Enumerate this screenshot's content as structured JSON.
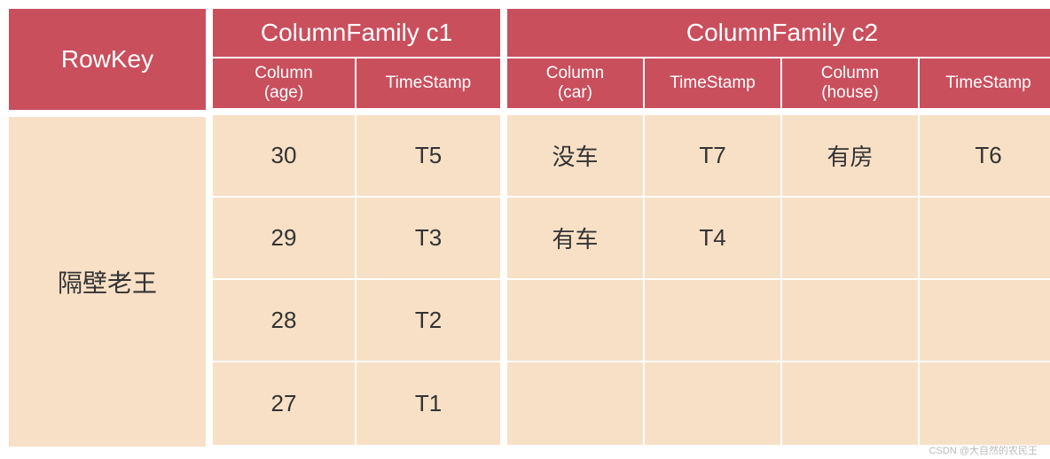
{
  "rowkey": {
    "header": "RowKey",
    "value": "隔壁老王"
  },
  "cf1": {
    "title": "ColumnFamily c1",
    "columns": [
      "Column\n(age)",
      "TimeStamp"
    ],
    "rows": [
      [
        "30",
        "T5"
      ],
      [
        "29",
        "T3"
      ],
      [
        "28",
        "T2"
      ],
      [
        "27",
        "T1"
      ]
    ]
  },
  "cf2": {
    "title": "ColumnFamily c2",
    "columns": [
      "Column\n(car)",
      "TimeStamp",
      "Column\n(house)",
      "TimeStamp"
    ],
    "rows": [
      [
        "没车",
        "T7",
        "有房",
        "T6"
      ],
      [
        "有车",
        "T4",
        "",
        ""
      ],
      [
        "",
        "",
        "",
        ""
      ],
      [
        "",
        "",
        "",
        ""
      ]
    ]
  },
  "watermark": "CSDN @大自然的农民王",
  "colors": {
    "header_bg": "#c94f5d",
    "body_bg": "#f8e0c6"
  }
}
